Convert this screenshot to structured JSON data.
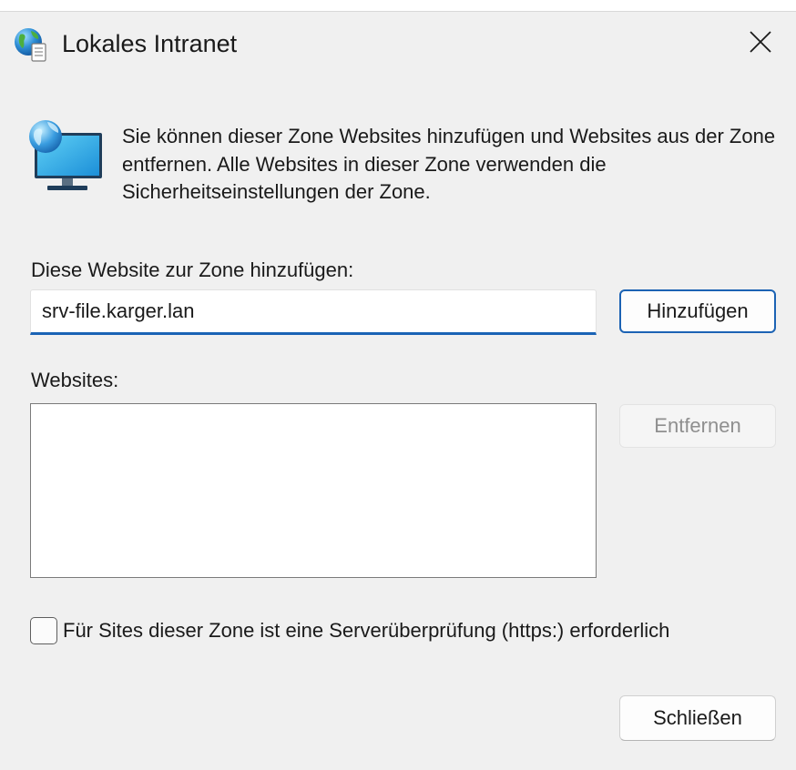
{
  "window": {
    "title": "Lokales Intranet",
    "title_icon": "globe-document-icon",
    "close_icon": "close-icon"
  },
  "info": {
    "icon": "globe-monitor-icon",
    "text": "Sie können dieser Zone Websites hinzufügen und Websites aus der Zone entfernen. Alle Websites in dieser Zone verwenden die Sicherheitseinstellungen der Zone."
  },
  "add_site": {
    "label": "Diese Website zur Zone hinzufügen:",
    "input_value": "srv-file.karger.lan",
    "button_label": "Hinzufügen"
  },
  "sites": {
    "label": "Websites:",
    "items": [],
    "remove_button_label": "Entfernen"
  },
  "https_check": {
    "label": "Für Sites dieser Zone ist eine Serverüberprüfung (https:) erforderlich",
    "checked": false
  },
  "footer": {
    "close_button_label": "Schließen"
  },
  "colors": {
    "accent": "#1a63b5",
    "dialog_background": "#f0f0f0",
    "disabled_text": "#8f8f8f"
  }
}
